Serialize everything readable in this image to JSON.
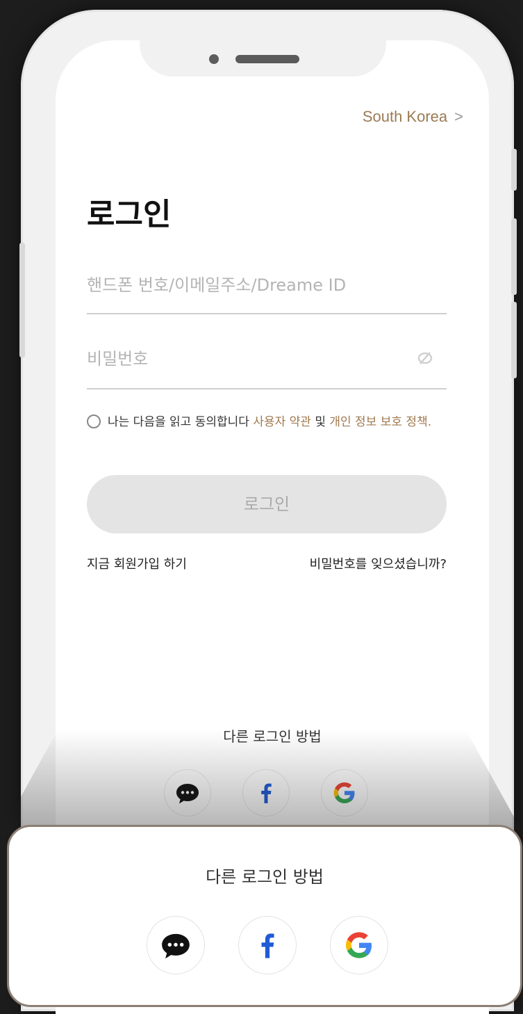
{
  "region": {
    "label": "South Korea",
    "chevron": ">"
  },
  "title": "로그인",
  "fields": {
    "account_placeholder": "핸드폰 번호/이메일주소/Dreame ID",
    "password_placeholder": "비밀번호"
  },
  "agreement": {
    "prefix": "나는 다음을 읽고 동의합니다",
    "terms": "사용자 약관",
    "and": "및",
    "privacy": "개인 정보 보호 정책."
  },
  "login_button": "로그인",
  "signup_link": "지금 회원가입 하기",
  "forgot_link": "비밀번호를 잊으셨습니까?",
  "other_login": {
    "title": "다른 로그인 방법",
    "providers": [
      "chat-icon",
      "facebook-icon",
      "google-icon"
    ]
  },
  "colors": {
    "accent": "#a0794f",
    "button_disabled": "#e4e4e4",
    "background": "#1e1d1d"
  }
}
